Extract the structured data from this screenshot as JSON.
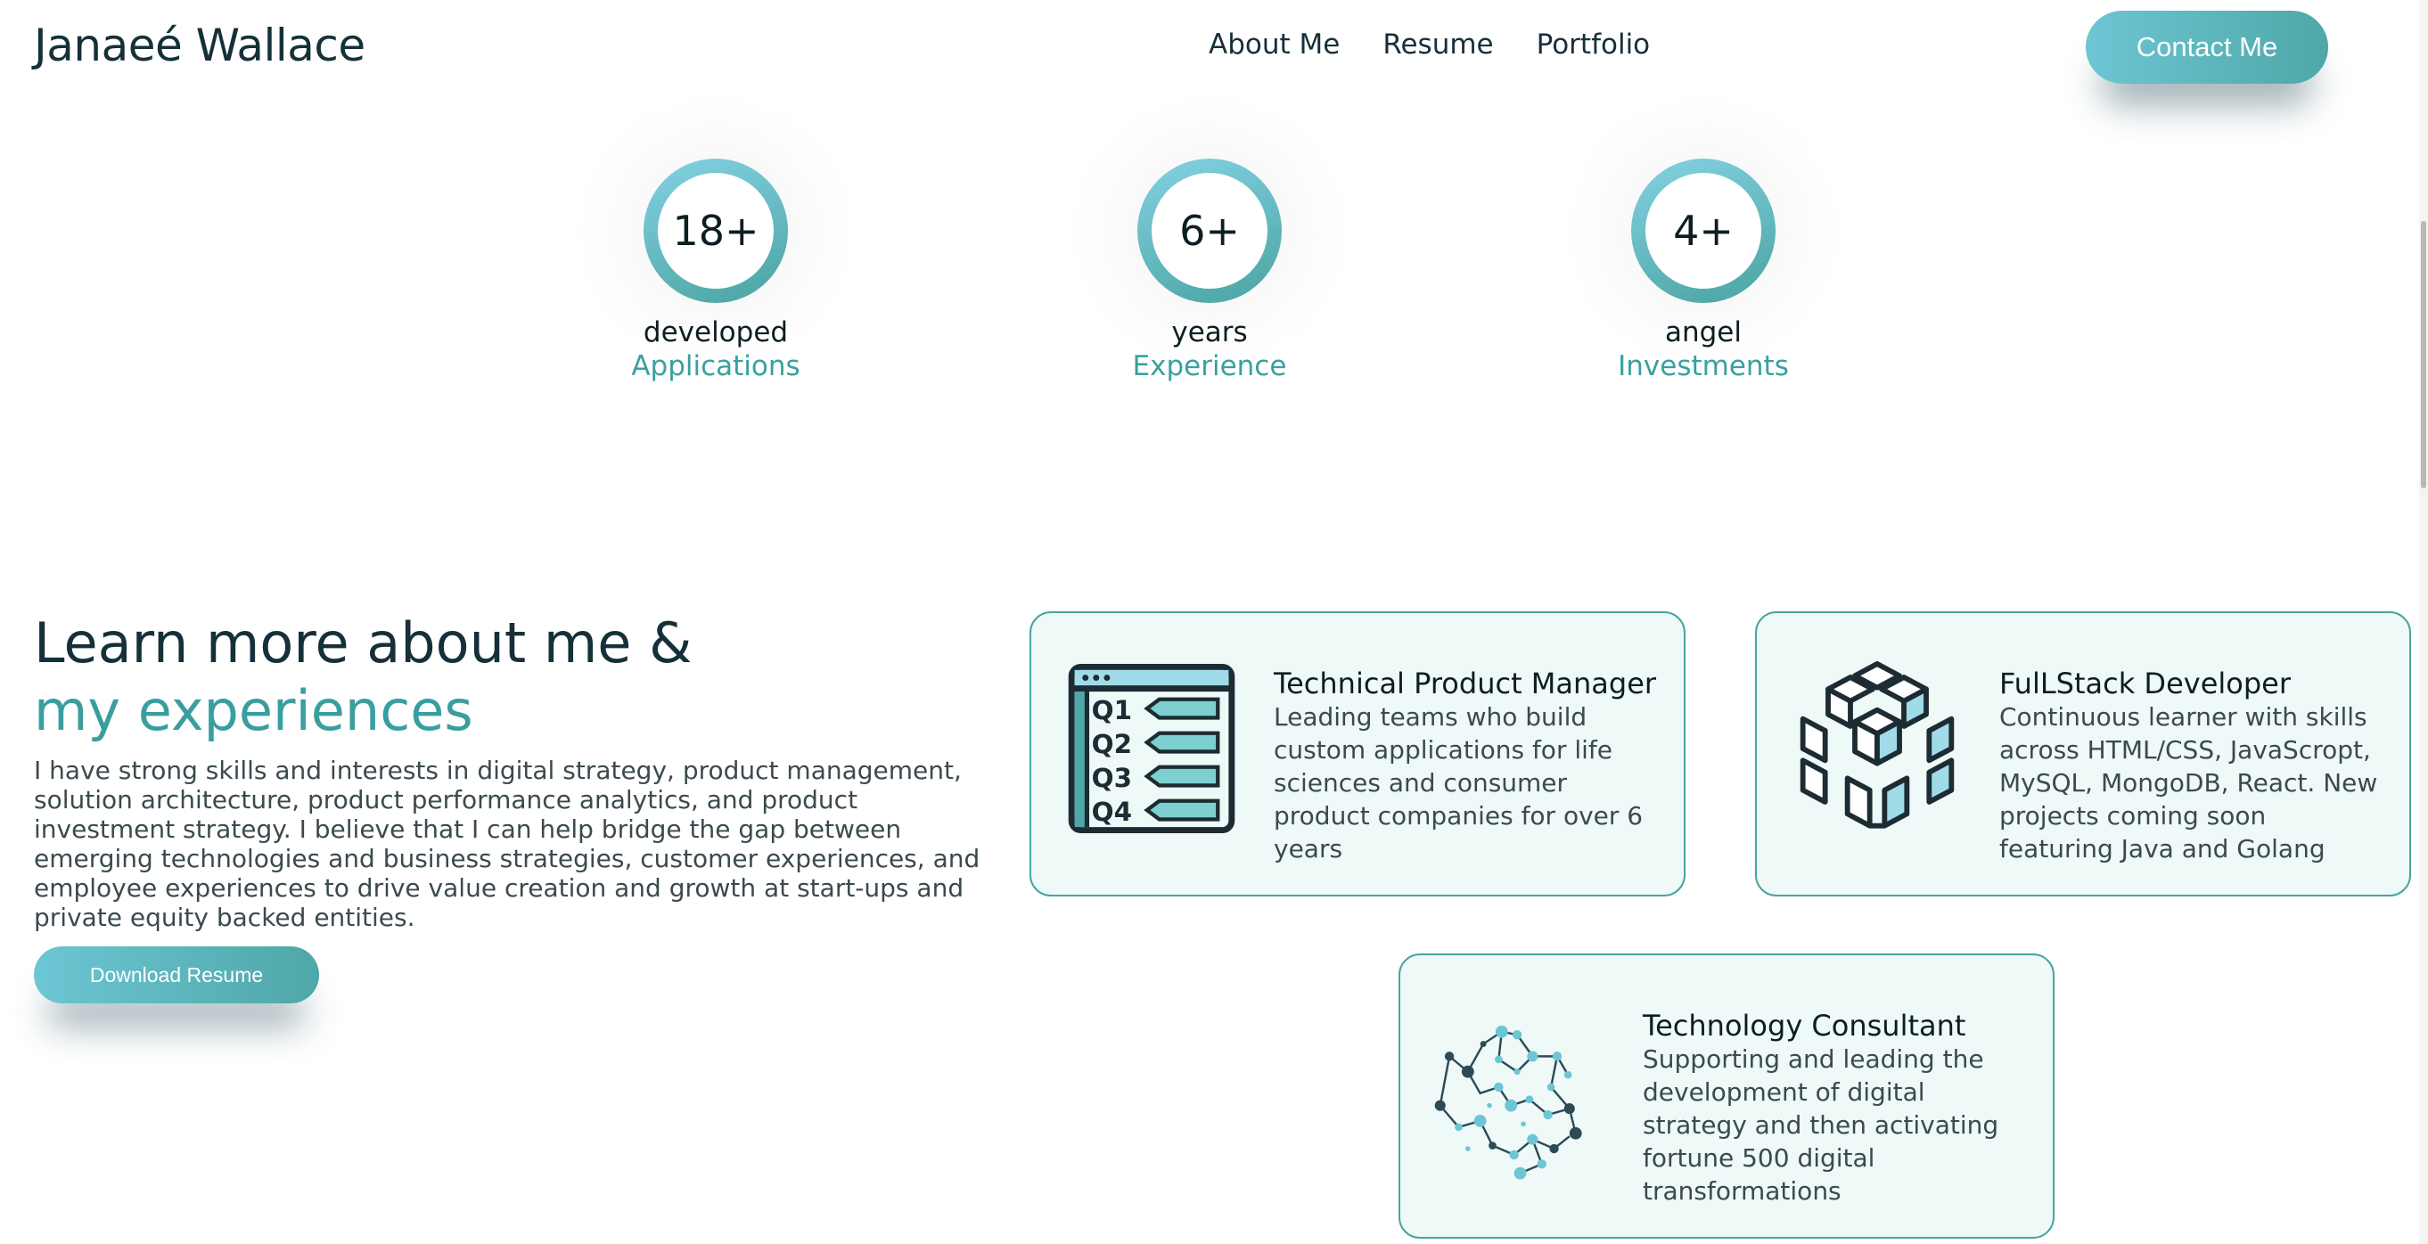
{
  "header": {
    "brand": "Janaeé Wallace",
    "nav": [
      "About Me",
      "Resume",
      "Portfolio"
    ],
    "contact_label": "Contact Me"
  },
  "stats": [
    {
      "value": "18+",
      "top": "developed",
      "bottom": "Applications"
    },
    {
      "value": "6+",
      "top": "years",
      "bottom": "Experience"
    },
    {
      "value": "4+",
      "top": "angel",
      "bottom": "Investments"
    }
  ],
  "about": {
    "title_line1": "Learn more about me &",
    "title_line2": "my experiences",
    "description": "I have strong skills and interests in digital strategy, product management, solution architecture, product performance analytics, and product investment strategy. I believe that I can help bridge the gap between emerging technologies and business strategies, customer experiences, and employee experiences to drive value creation and growth at start-ups and private equity backed entities.",
    "download_label": "Download Resume"
  },
  "cards": [
    {
      "title": "Technical Product Manager",
      "desc": "Leading teams who build custom applications for life sciences and consumer product companies for over 6 years",
      "icon": "quarterly-checklist-icon",
      "icon_text": [
        "Q1",
        "Q2",
        "Q3",
        "Q4"
      ]
    },
    {
      "title": "FulLStack Developer",
      "desc": "Continuous learner with skills across HTML/CSS, JavaScropt, MySQL, MongoDB, React. New projects coming soon featuring Java and Golang",
      "icon": "cubes-icon"
    },
    {
      "title": "Technology Consultant",
      "desc": "Supporting and leading the development of digital strategy and then activating fortune 500 digital transformations",
      "icon": "network-brain-icon"
    }
  ],
  "colors": {
    "accent": "#3a9e9e",
    "button_gradient_start": "#6cc6d4",
    "button_gradient_end": "#4fa7a7",
    "card_background": "#eef9f8",
    "heading": "#16303a"
  }
}
